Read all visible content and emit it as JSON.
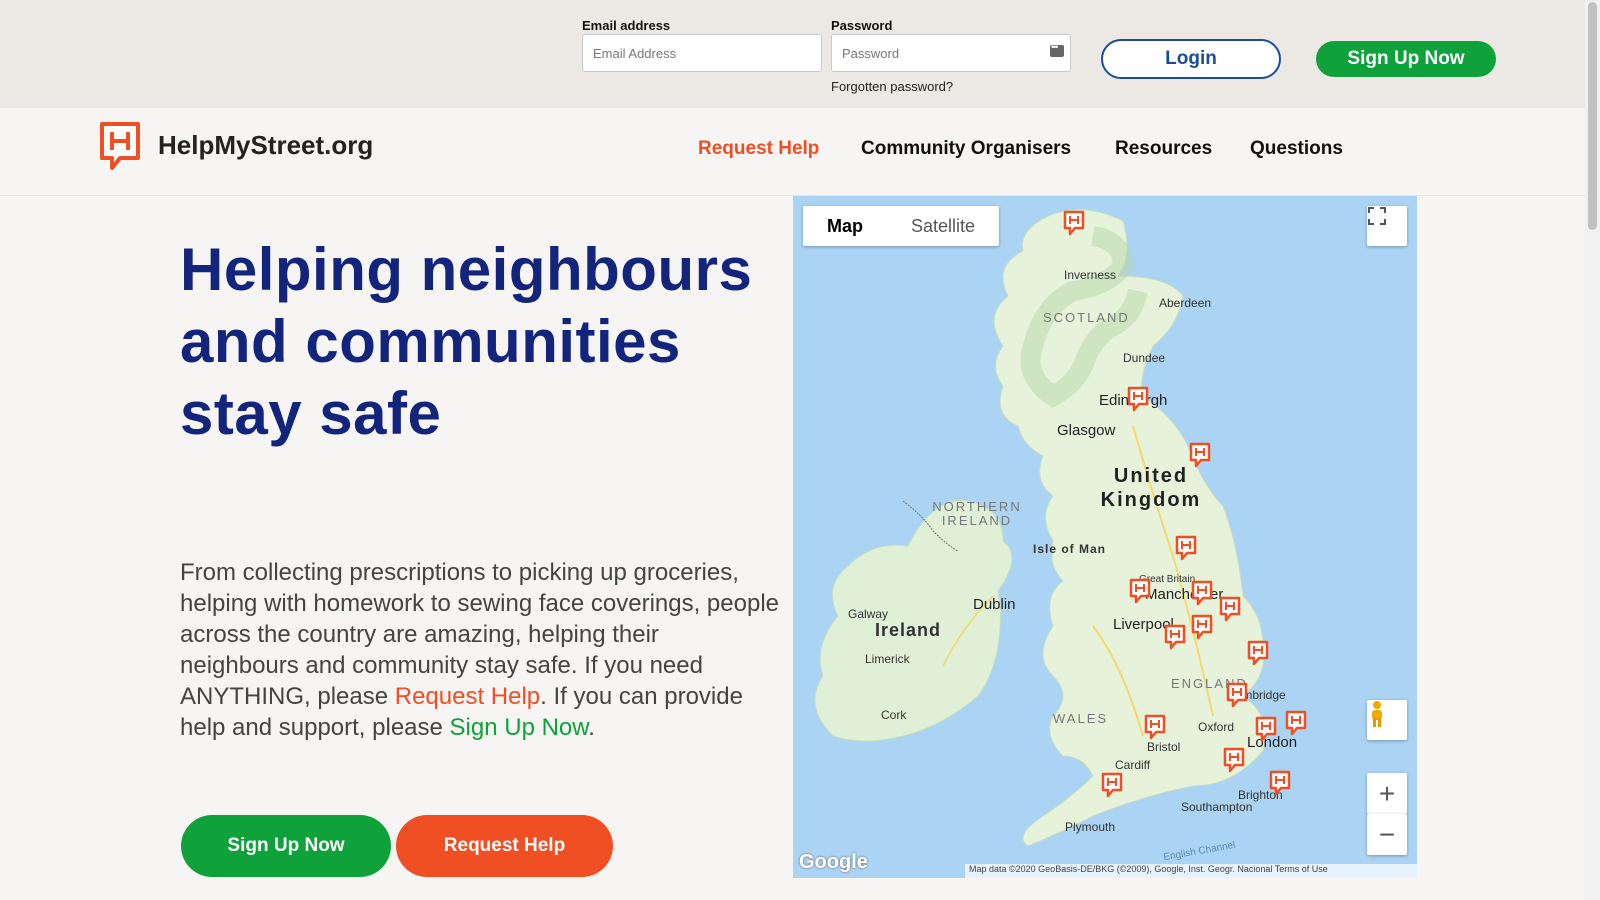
{
  "login": {
    "email_label": "Email address",
    "email_placeholder": "Email Address",
    "password_label": "Password",
    "password_placeholder": "Password",
    "forgot": "Forgotten password?",
    "login_button": "Login",
    "signup_button": "Sign Up Now"
  },
  "brand": {
    "name": "HelpMyStreet.org",
    "colors": {
      "primary_red": "#f04e23",
      "green": "#0fa23b",
      "navy": "#13247c"
    }
  },
  "nav": {
    "items": [
      {
        "label": "Request Help",
        "active": true
      },
      {
        "label": "Community Organisers"
      },
      {
        "label": "Resources"
      },
      {
        "label": "Questions"
      }
    ]
  },
  "hero": {
    "title": "Helping neighbours and communities stay safe",
    "body_main": "From collecting prescriptions to picking up groceries, helping with homework to sewing face coverings, people across the country are amazing, helping their neighbours and community stay safe. If you need ANYTHING, please ",
    "body_link1": "Request Help",
    "body_mid": ". If you can provide help and support, please ",
    "body_link2": "Sign Up Now",
    "body_end": ".",
    "btn_signup": "Sign Up Now",
    "btn_request": "Request Help"
  },
  "map": {
    "type_map": "Map",
    "type_satellite": "Satellite",
    "labels": {
      "inverness": "Inverness",
      "aberdeen": "Aberdeen",
      "scotland": "SCOTLAND",
      "dundee": "Dundee",
      "edinburgh": "Edinburgh",
      "glasgow": "Glasgow",
      "uk": "United Kingdom",
      "northern_ireland": "NORTHERN IRELAND",
      "isle_of_man": "Isle of Man",
      "great_britain": "Great Britain",
      "manchester": "Manchester",
      "liverpool": "Liverpool",
      "galway": "Galway",
      "dublin": "Dublin",
      "ireland": "Ireland",
      "limerick": "Limerick",
      "england": "ENGLAND",
      "cambridge": "Cambridge",
      "wales": "WALES",
      "oxford": "Oxford",
      "cork": "Cork",
      "bristol": "Bristol",
      "london": "London",
      "cardiff": "Cardiff",
      "brighton": "Brighton",
      "southampton": "Southampton",
      "plymouth": "Plymouth",
      "english_channel": "English Channel"
    },
    "google": "Google",
    "attribution": "Map data ©2020 GeoBasis-DE/BKG (©2009), Google, Inst. Geogr. Nacional   Terms of Use",
    "icons": {
      "fullscreen": "fullscreen-icon",
      "pegman": "pegman-icon",
      "zoom_in": "zoom-in-icon",
      "zoom_out": "zoom-out-icon",
      "marker": "helpmystreet-marker-icon"
    },
    "marker_count": 20
  }
}
